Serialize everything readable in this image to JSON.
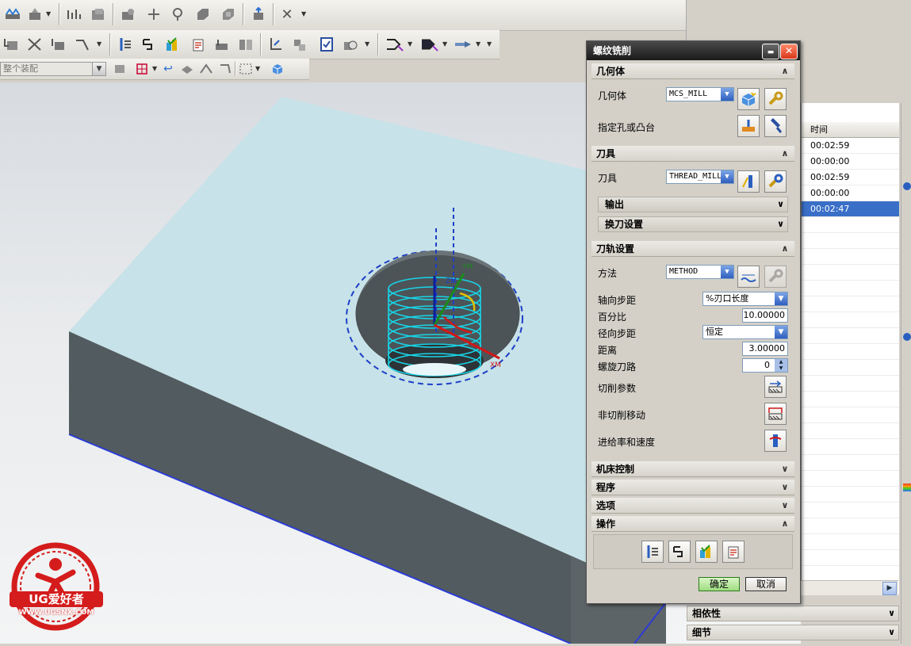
{
  "toolbar": {
    "assembly_combo_value": "整个装配"
  },
  "dialog": {
    "title": "螺纹铣削",
    "close_symbol": "✕",
    "min_symbol": "▬",
    "sections": {
      "geometry": {
        "header": "几何体",
        "geometry_label": "几何体",
        "geometry_value": "MCS_MILL",
        "hole_label": "指定孔或凸台"
      },
      "tool": {
        "header": "刀具",
        "tool_label": "刀具",
        "tool_value": "THREAD_MILL",
        "output_label": "输出",
        "tool_change_label": "换刀设置"
      },
      "path": {
        "header": "刀轨设置",
        "method_label": "方法",
        "method_value": "METHOD",
        "axial_step_label": "轴向步距",
        "axial_step_value": "%刃口长度",
        "percent_label": "百分比",
        "percent_value": "10.00000",
        "radial_step_label": "径向步距",
        "radial_step_value": "恒定",
        "distance_label": "距离",
        "distance_value": "3.00000",
        "helical_label": "螺旋刀路",
        "helical_value": "0",
        "cut_params_label": "切削参数",
        "non_cut_label": "非切削移动",
        "feeds_label": "进给率和速度"
      },
      "machine_control": {
        "header": "机床控制"
      },
      "program": {
        "header": "程序"
      },
      "options": {
        "header": "选项"
      },
      "actions": {
        "header": "操作"
      }
    },
    "ok_label": "确定",
    "cancel_label": "取消"
  },
  "nav": {
    "column_header": "时间",
    "rows": [
      "00:02:59",
      "00:00:00",
      "00:02:59",
      "00:00:00",
      "00:02:47"
    ],
    "selected_index": 4
  },
  "bottom_panels": {
    "dependencies": "相依性",
    "details": "细节"
  },
  "viewport": {
    "axis_labels": {
      "zm": "ZM",
      "ym": "YM",
      "xm": "XM"
    }
  },
  "logo": {
    "brand": "UG爱好者",
    "url": "WWW.UGSNX.COM"
  },
  "colors": {
    "part_top": "#c7e2e8",
    "part_side": "#525b5f",
    "helix": "#18d4e6",
    "selection_blue": "#3a6fc8",
    "logo_red": "#d41c1c"
  }
}
